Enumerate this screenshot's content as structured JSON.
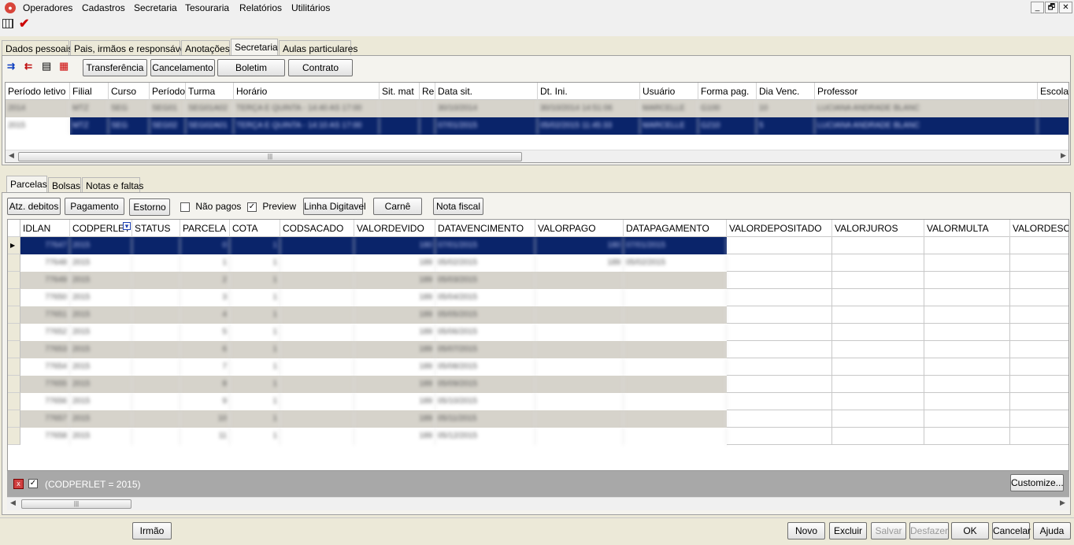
{
  "menu": [
    "Operadores",
    "Cadastros",
    "Secretaria",
    "Tesouraria",
    "Relatórios",
    "Utilitários"
  ],
  "window_controls": {
    "minimize": "_",
    "restore": "🗗",
    "close": "✕"
  },
  "tabs_main": [
    {
      "label": "Dados pessoais"
    },
    {
      "label": "Pais, irmãos e responsáveis"
    },
    {
      "label": "Anotações"
    },
    {
      "label": "Secretaria",
      "active": true
    },
    {
      "label": "Aulas particulares"
    }
  ],
  "secretaria_toolbar": {
    "transfer": "Transferência",
    "cancel": "Cancelamento",
    "boletim": "Boletim",
    "contrato": "Contrato"
  },
  "enrollment_grid": {
    "columns": [
      "Período letivo",
      "Filial",
      "Curso",
      "Período",
      "Turma",
      "Horário",
      "Sit. mat",
      "Re",
      "Data sit.",
      "Dt. Ini.",
      "Usuário",
      "Forma pag.",
      "Dia Venc.",
      "Professor",
      "Escola"
    ],
    "rows": [
      [
        "2014",
        "MTZ",
        "SEG",
        "SEG01",
        "SEG01A02",
        "TERÇA E QUINTA - 14:40 AS 17:00",
        "",
        "",
        "30/10/2014",
        "30/10/2014 14:51:06",
        "MARCELLE",
        "G100",
        "10",
        "LUCIANA ANDRADE BLANC",
        ""
      ],
      [
        "2015",
        "MTZ",
        "SEG",
        "SEG02",
        "SEG02A01",
        "TERÇA E QUINTA - 14:10 AS 17:00",
        "",
        "",
        "07/01/2015",
        "05/02/2015 11:45:33",
        "MARCELLE",
        "G210",
        "5",
        "LUCIANA ANDRADE BLANC",
        ""
      ]
    ]
  },
  "tabs_sub": [
    {
      "label": "Parcelas",
      "active": true
    },
    {
      "label": "Bolsas"
    },
    {
      "label": "Notas e faltas"
    }
  ],
  "parcelas_toolbar": {
    "atz": "Atz. debitos",
    "pagamento": "Pagamento",
    "estorno": "Estorno",
    "nao_pagos": "Não pagos",
    "nao_pagos_checked": false,
    "preview": "Preview",
    "preview_checked": true,
    "linha_digitavel": "Linha Digitavel",
    "carne": "Carnê",
    "nota_fiscal": "Nota fiscal"
  },
  "parcelas_grid": {
    "columns": [
      "IDLAN",
      "CODPERLET",
      "STATUS",
      "PARCELA",
      "COTA",
      "CODSACADO",
      "VALORDEVIDO",
      "DATAVENCIMENTO",
      "VALORPAGO",
      "DATAPAGAMENTO",
      "VALORDEPOSITADO",
      "VALORJUROS",
      "VALORMULTA",
      "VALORDESC"
    ],
    "rows": [
      [
        "77647",
        "2015",
        "",
        "0",
        "1",
        "",
        "180",
        "07/01/2015",
        "180",
        "07/01/2015"
      ],
      [
        "77648",
        "2015",
        "",
        "1",
        "1",
        "",
        "189",
        "05/02/2015",
        "189",
        "05/02/2015"
      ],
      [
        "77649",
        "2015",
        "",
        "2",
        "1",
        "",
        "189",
        "05/03/2015",
        "",
        ""
      ],
      [
        "77650",
        "2015",
        "",
        "3",
        "1",
        "",
        "189",
        "05/04/2015",
        "",
        ""
      ],
      [
        "77651",
        "2015",
        "",
        "4",
        "1",
        "",
        "189",
        "05/05/2015",
        "",
        ""
      ],
      [
        "77652",
        "2015",
        "",
        "5",
        "1",
        "",
        "189",
        "05/06/2015",
        "",
        ""
      ],
      [
        "77653",
        "2015",
        "",
        "6",
        "1",
        "",
        "189",
        "05/07/2015",
        "",
        ""
      ],
      [
        "77654",
        "2015",
        "",
        "7",
        "1",
        "",
        "189",
        "05/08/2015",
        "",
        ""
      ],
      [
        "77655",
        "2015",
        "",
        "8",
        "1",
        "",
        "189",
        "05/09/2015",
        "",
        ""
      ],
      [
        "77656",
        "2015",
        "",
        "9",
        "1",
        "",
        "189",
        "05/10/2015",
        "",
        ""
      ],
      [
        "77657",
        "2015",
        "",
        "10",
        "1",
        "",
        "189",
        "05/11/2015",
        "",
        ""
      ],
      [
        "77658",
        "2015",
        "",
        "11",
        "1",
        "",
        "189",
        "05/12/2015",
        "",
        ""
      ]
    ]
  },
  "filter_bar": {
    "text": "(CODPERLET = 2015)",
    "customize": "Customize..."
  },
  "footer": {
    "irmao": "Irmão",
    "novo": "Novo",
    "excluir": "Excluir",
    "salvar": "Salvar",
    "desfazer": "Desfazer",
    "ok": "OK",
    "cancelar": "Cancelar",
    "ajuda": "Ajuda"
  },
  "colors": {
    "selection": "#0a246a",
    "row_alt": "#d6d3cb",
    "filter_bar": "#a0a0a0"
  }
}
